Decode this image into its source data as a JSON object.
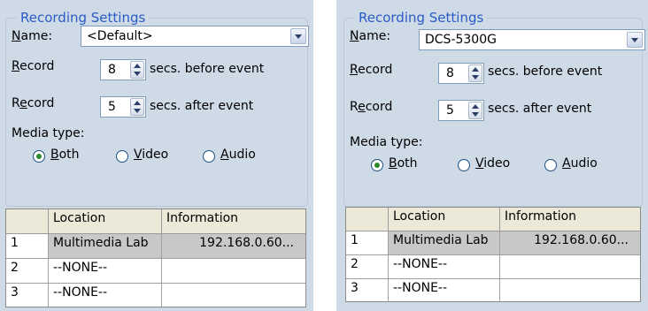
{
  "panels": [
    {
      "legend": "Recording Settings",
      "name_label": "Name:",
      "name_value": "<Default>",
      "record_before_label": "Record",
      "record_before_value": "8",
      "before_suffix": "secs. before event",
      "record_after_label": "Record",
      "record_after_value": "5",
      "after_suffix": "secs. after event",
      "media_type_label": "Media type:",
      "media_options": [
        "Both",
        "Video",
        "Audio"
      ],
      "media_selected": "Both",
      "table": {
        "headers": [
          "",
          "Location",
          "Information"
        ],
        "rows": [
          [
            "1",
            "Multimedia Lab",
            "192.168.0.60..."
          ],
          [
            "2",
            "--NONE--",
            ""
          ],
          [
            "3",
            "--NONE--",
            ""
          ]
        ]
      }
    },
    {
      "legend": "Recording Settings",
      "name_label": "Name:",
      "name_value": "DCS-5300G",
      "record_before_label": "Record",
      "record_before_value": "8",
      "before_suffix": "secs. before event",
      "record_after_label": "Record",
      "record_after_value": "5",
      "after_suffix": "secs. after event",
      "media_type_label": "Media type:",
      "media_options": [
        "Both",
        "Video",
        "Audio"
      ],
      "media_selected": "Both",
      "table": {
        "headers": [
          "",
          "Location",
          "Information"
        ],
        "rows": [
          [
            "1",
            "Multimedia Lab",
            "192.168.0.60..."
          ],
          [
            "2",
            "--NONE--",
            ""
          ],
          [
            "3",
            "--NONE--",
            ""
          ]
        ]
      }
    }
  ]
}
